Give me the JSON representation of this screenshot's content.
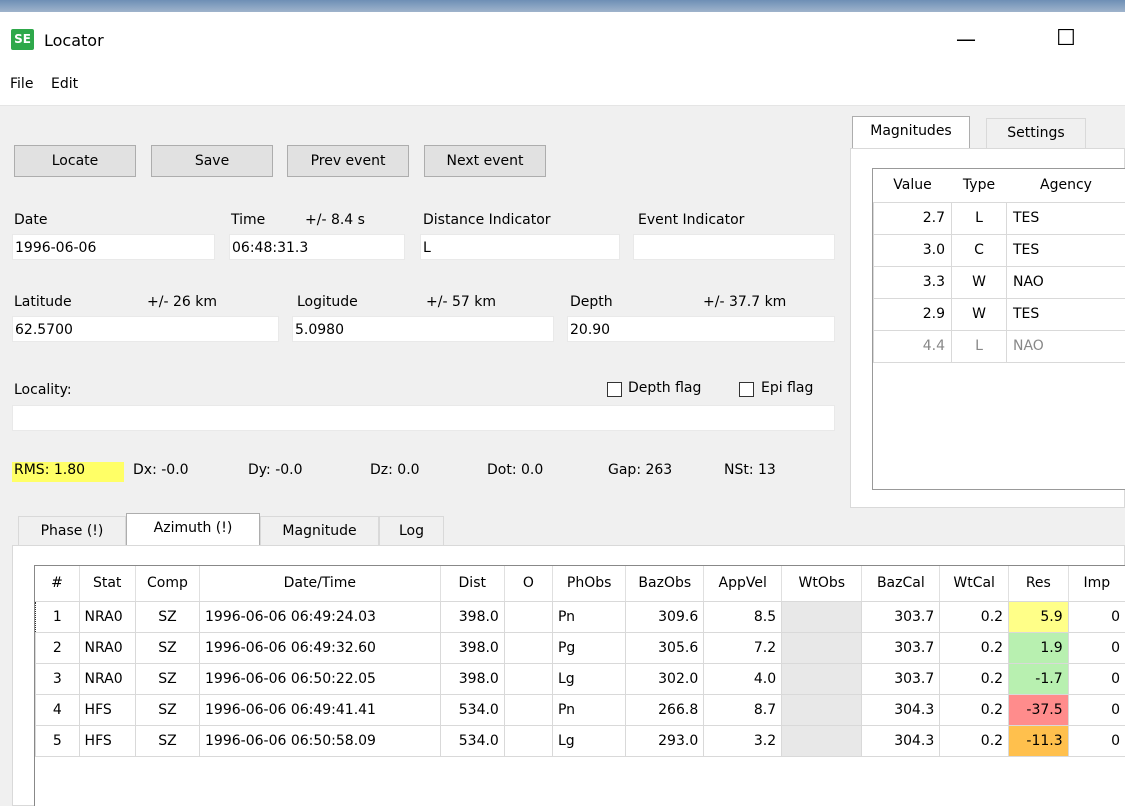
{
  "window": {
    "title": "Locator",
    "app_icon": "SE",
    "minimize": "—",
    "maximize": "☐"
  },
  "menu": {
    "file": "File",
    "edit": "Edit"
  },
  "toolbar": {
    "locate": "Locate",
    "save": "Save",
    "prev": "Prev event",
    "next": "Next event"
  },
  "event": {
    "date_label": "Date",
    "date": "1996-06-06",
    "time_label": "Time",
    "time_err": "+/- 8.4 s",
    "time": "06:48:31.3",
    "dist_ind_label": "Distance Indicator",
    "dist_ind": "L",
    "event_ind_label": "Event Indicator",
    "event_ind": "",
    "lat_label": "Latitude",
    "lat_err": "+/- 26 km",
    "lat": "62.5700",
    "lon_label": "Logitude",
    "lon_err": "+/- 57 km",
    "lon": "5.0980",
    "depth_label": "Depth",
    "depth_err": "+/- 37.7 km",
    "depth": "20.90",
    "locality_label": "Locality:",
    "locality": "",
    "depth_flag": "Depth flag",
    "epi_flag": "Epi flag"
  },
  "stats": {
    "rms": "RMS: 1.80",
    "dx": "Dx: -0.0",
    "dy": "Dy: -0.0",
    "dz": "Dz: 0.0",
    "dot": "Dot: 0.0",
    "gap": "Gap: 263",
    "nst": "NSt: 13"
  },
  "tabs": {
    "phase": "Phase (!)",
    "azimuth": "Azimuth (!)",
    "magnitude": "Magnitude",
    "log": "Log"
  },
  "right_tabs": {
    "magnitudes": "Magnitudes",
    "settings": "Settings"
  },
  "magnitudes": {
    "headers": [
      "Value",
      "Type",
      "Agency"
    ],
    "rows": [
      [
        "2.7",
        "L",
        "TES"
      ],
      [
        "3.0",
        "C",
        "TES"
      ],
      [
        "3.3",
        "W",
        "NAO"
      ],
      [
        "2.9",
        "W",
        "TES"
      ],
      [
        "4.4",
        "L",
        "NAO"
      ]
    ]
  },
  "azimuth_table": {
    "headers": [
      "#",
      "Stat",
      "Comp",
      "Date/Time",
      "Dist",
      "O",
      "PhObs",
      "BazObs",
      "AppVel",
      "WtObs",
      "BazCal",
      "WtCal",
      "Res",
      "Imp"
    ],
    "rows": [
      [
        "1",
        "NRA0",
        "SZ",
        "1996-06-06 06:49:24.03",
        "398.0",
        "",
        "Pn",
        "309.6",
        "8.5",
        "",
        "303.7",
        "0.2",
        "5.9",
        "0"
      ],
      [
        "2",
        "NRA0",
        "SZ",
        "1996-06-06 06:49:32.60",
        "398.0",
        "",
        "Pg",
        "305.6",
        "7.2",
        "",
        "303.7",
        "0.2",
        "1.9",
        "0"
      ],
      [
        "3",
        "NRA0",
        "SZ",
        "1996-06-06 06:50:22.05",
        "398.0",
        "",
        "Lg",
        "302.0",
        "4.0",
        "",
        "303.7",
        "0.2",
        "-1.7",
        "0"
      ],
      [
        "4",
        "HFS",
        "SZ",
        "1996-06-06 06:49:41.41",
        "534.0",
        "",
        "Pn",
        "266.8",
        "8.7",
        "",
        "304.3",
        "0.2",
        "-37.5",
        "0"
      ],
      [
        "5",
        "HFS",
        "SZ",
        "1996-06-06 06:50:58.09",
        "534.0",
        "",
        "Lg",
        "293.0",
        "3.2",
        "",
        "304.3",
        "0.2",
        "-11.3",
        "0"
      ]
    ],
    "res_colors": [
      "#ffff88",
      "#b8f0b0",
      "#b8f0b0",
      "#ff8c8c",
      "#ffc04d"
    ]
  }
}
